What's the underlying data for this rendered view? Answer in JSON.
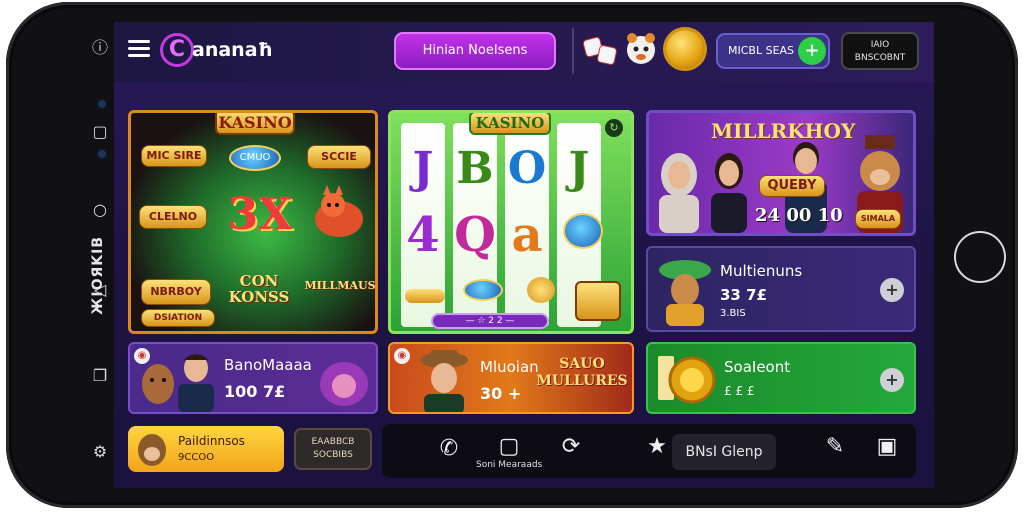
{
  "device": {
    "brand_vertical": "ЖIOЯKIB"
  },
  "header": {
    "logo_letter": "C",
    "logo_text": "ananaħ",
    "promo_button": "Hinian NoeIsens",
    "account_button": "MICBL SEAS",
    "account_plus": "+",
    "balance_line1": "IAIO",
    "balance_line2": "BNSCOBNT"
  },
  "cards": {
    "casino1": {
      "title": "KASINO",
      "labels": [
        "MIC SIRE",
        "CMUO",
        "SCCIE",
        "CLELNO",
        "3X",
        "NBRBOY",
        "CON KONSS",
        "MILLMAUS",
        "DSIATION"
      ]
    },
    "casino2": {
      "title": "KASINO",
      "symbols": [
        "J",
        "B",
        "O",
        "J",
        "4",
        "Q",
        "a"
      ],
      "pill_label": "— ☆ 2 2 —"
    },
    "millionaire": {
      "title": "MILLRKHOY",
      "badge": "QUEBY",
      "amount": "24 00 10",
      "tag": "SIMALA"
    },
    "mulriens": {
      "title": "Multienuns",
      "value": "33 7£",
      "sub": "3.BIS",
      "plus": "+"
    },
    "bandhaaa": {
      "title": "BanoMaaaa",
      "value": "100 7£"
    },
    "mluobian": {
      "title": "Mluoian",
      "value": "30 +",
      "badge": "SAUO MULLURES"
    },
    "soaleont": {
      "title": "SoaIeont",
      "value": "£ £ £",
      "plus": "+"
    }
  },
  "bottom": {
    "yellow_btn_line1": "PaiIdinnsos",
    "yellow_btn_line2": "9CCOO",
    "dark_btn_line1": "EAABBCB",
    "dark_btn_line2": "SOCBIBS",
    "nav_caption": "Soni Mearaads",
    "nav_pill": "BNsI Glenp"
  },
  "colors": {
    "accent_purple": "#c232ea",
    "accent_green": "#2dcf46",
    "gold": "#e3a20f"
  }
}
